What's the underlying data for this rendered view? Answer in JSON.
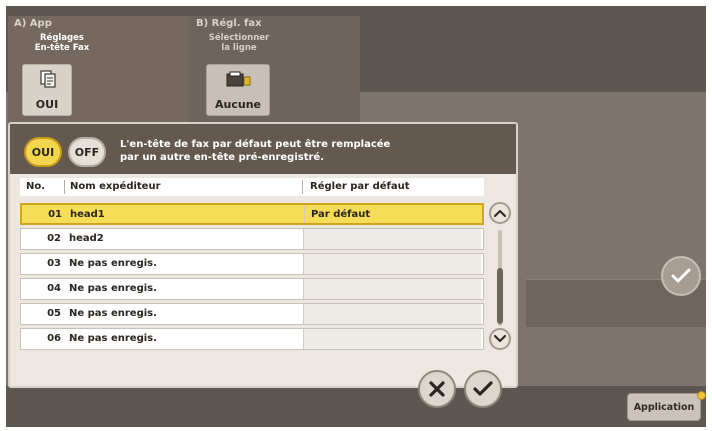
{
  "tabs": {
    "a": {
      "title": "A)  App",
      "line1": "Réglages",
      "line2": "En-tête Fax",
      "tile_label": "OUI",
      "icon": "fax-header-icon"
    },
    "b": {
      "title": "B)  Régl. fax",
      "line1": "Sélectionner",
      "line2": "la ligne",
      "tile_label": "Aucune",
      "icon": "fax-line-icon"
    }
  },
  "dialog": {
    "toggle_on": "OUI",
    "toggle_off": "OFF",
    "message_line1": "L'en-tête de fax par défaut peut être remplacée",
    "message_line2": "par un autre en-tête pré-enregistré.",
    "columns": {
      "no": "No.",
      "name": "Nom expéditeur",
      "default": "Régler par défaut"
    },
    "rows": [
      {
        "no": "01",
        "name": "head1",
        "default": "Par défaut",
        "selected": true
      },
      {
        "no": "02",
        "name": "head2",
        "default": ""
      },
      {
        "no": "03",
        "name": "Ne pas enregis.",
        "default": ""
      },
      {
        "no": "04",
        "name": "Ne pas enregis.",
        "default": ""
      },
      {
        "no": "05",
        "name": "Ne pas enregis.",
        "default": ""
      },
      {
        "no": "06",
        "name": "Ne pas enregis.",
        "default": ""
      }
    ],
    "scroll_up_icon": "chevron-up-icon",
    "scroll_down_icon": "chevron-down-icon",
    "cancel_icon": "close-icon",
    "ok_icon": "check-icon"
  },
  "sidebar": {
    "confirm_icon": "check-icon"
  },
  "footer": {
    "application_label": "Application"
  },
  "colors": {
    "selection": "#f6dd57",
    "header_bar": "#64594f",
    "screen_bg": "#7d746b"
  }
}
